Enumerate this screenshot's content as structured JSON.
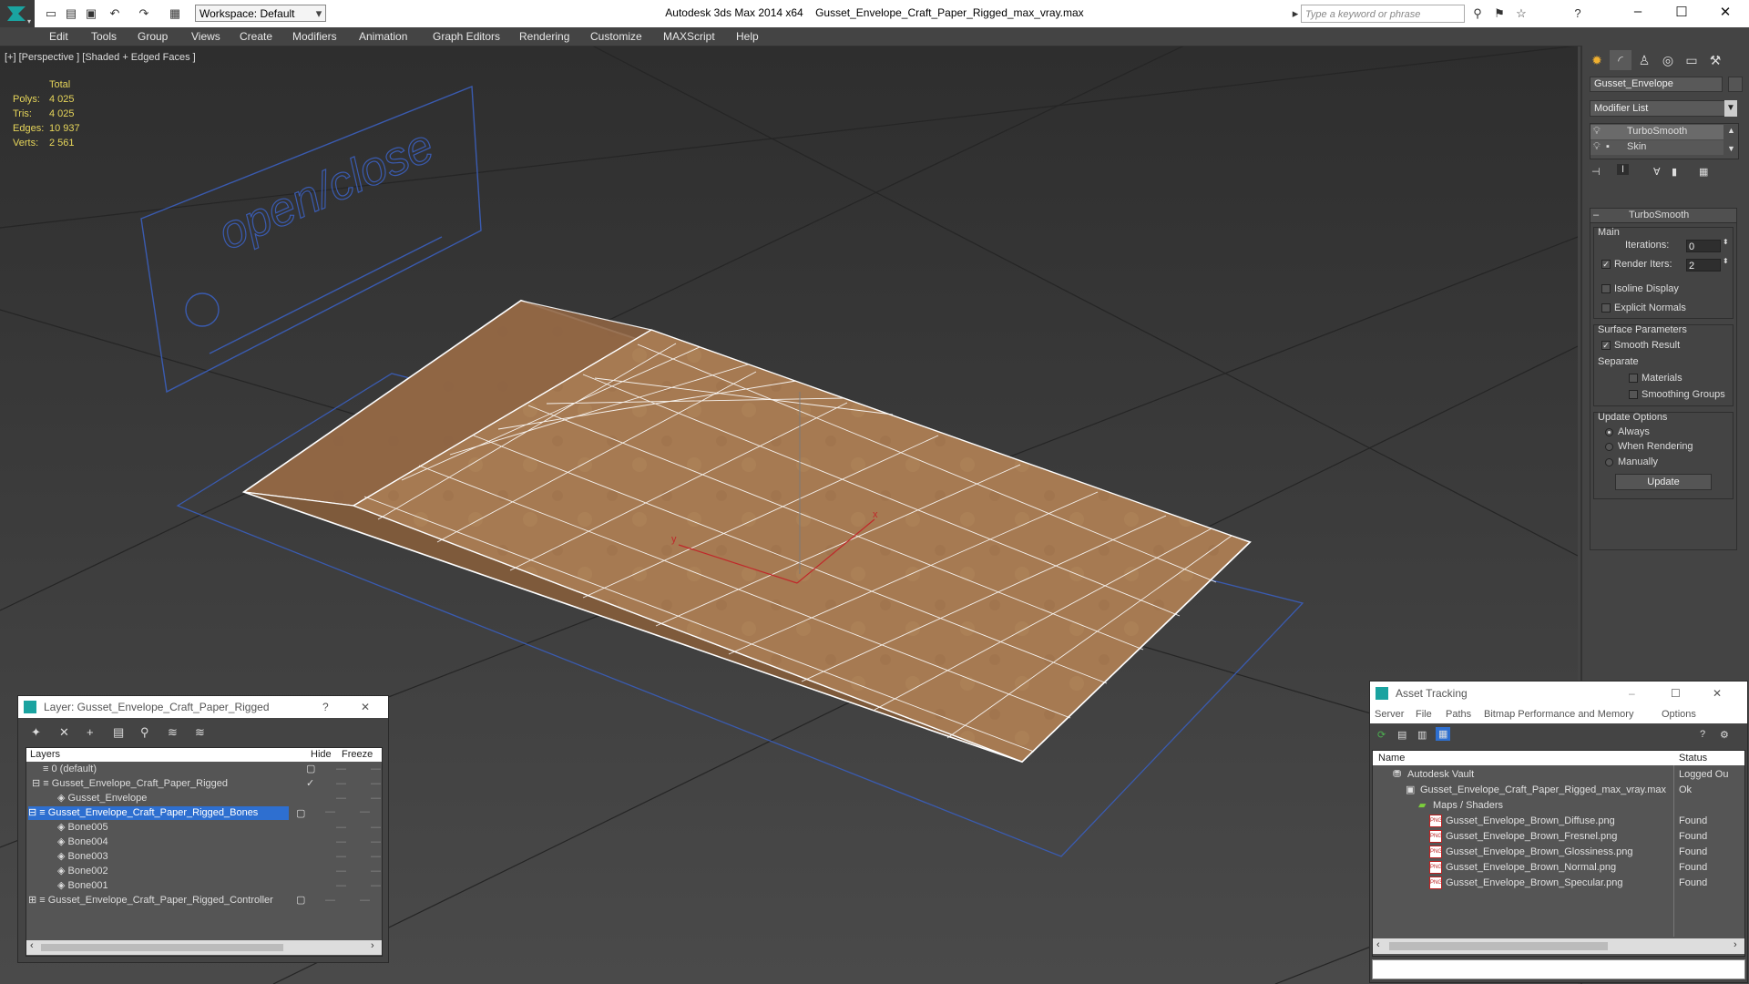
{
  "titlebar": {
    "app": "Autodesk 3ds Max  2014 x64",
    "file": "Gusset_Envelope_Craft_Paper_Rigged_max_vray.max",
    "workspace": "Workspace: Default",
    "search_placeholder": "Type a keyword or phrase"
  },
  "menu": [
    "Edit",
    "Tools",
    "Group",
    "Views",
    "Create",
    "Modifiers",
    "Animation",
    "Graph Editors",
    "Rendering",
    "Customize",
    "MAXScript",
    "Help"
  ],
  "viewport": {
    "label": "[+] [Perspective ] [Shaded + Edged Faces ]",
    "stats": {
      "total": "Total",
      "polys_label": "Polys:",
      "polys": "4 025",
      "tris_label": "Tris:",
      "tris": "4 025",
      "edges_label": "Edges:",
      "edges": "10 937",
      "verts_label": "Verts:",
      "verts": "2 561"
    },
    "sign_text": "open/close",
    "axis_x": "x",
    "axis_y": "y"
  },
  "command_panel": {
    "object_name": "Gusset_Envelope",
    "modifier_list": "Modifier List",
    "stack": [
      "TurboSmooth",
      "Skin"
    ],
    "rollout_title": "TurboSmooth",
    "main": "Main",
    "iterations_label": "Iterations:",
    "iterations": "0",
    "render_iters_label": "Render Iters:",
    "render_iters": "2",
    "render_iters_checked": true,
    "isoline": "Isoline Display",
    "explicit_normals": "Explicit Normals",
    "surface_params": "Surface Parameters",
    "smooth_result": "Smooth Result",
    "separate": "Separate",
    "materials": "Materials",
    "smoothing_groups": "Smoothing Groups",
    "update_options": "Update Options",
    "always": "Always",
    "when_rendering": "When Rendering",
    "manually": "Manually",
    "update_btn": "Update"
  },
  "layer_window": {
    "title": "Layer: Gusset_Envelope_Craft_Paper_Rigged",
    "col_layers": "Layers",
    "col_hide": "Hide",
    "col_freeze": "Freeze",
    "rows": [
      {
        "name": "0 (default)"
      },
      {
        "name": "Gusset_Envelope_Craft_Paper_Rigged"
      },
      {
        "name": "Gusset_Envelope"
      },
      {
        "name": "Gusset_Envelope_Craft_Paper_Rigged_Bones"
      },
      {
        "name": "Bone005"
      },
      {
        "name": "Bone004"
      },
      {
        "name": "Bone003"
      },
      {
        "name": "Bone002"
      },
      {
        "name": "Bone001"
      },
      {
        "name": "Gusset_Envelope_Craft_Paper_Rigged_Controller"
      }
    ]
  },
  "asset_window": {
    "title": "Asset Tracking",
    "menu": [
      "Server",
      "File",
      "Paths",
      "Bitmap Performance and Memory",
      "Options"
    ],
    "col_name": "Name",
    "col_status": "Status",
    "rows": [
      {
        "name": "Autodesk Vault",
        "status": "Logged Ou"
      },
      {
        "name": "Gusset_Envelope_Craft_Paper_Rigged_max_vray.max",
        "status": "Ok"
      },
      {
        "name": "Maps / Shaders",
        "status": ""
      },
      {
        "name": "Gusset_Envelope_Brown_Diffuse.png",
        "status": "Found"
      },
      {
        "name": "Gusset_Envelope_Brown_Fresnel.png",
        "status": "Found"
      },
      {
        "name": "Gusset_Envelope_Brown_Glossiness.png",
        "status": "Found"
      },
      {
        "name": "Gusset_Envelope_Brown_Normal.png",
        "status": "Found"
      },
      {
        "name": "Gusset_Envelope_Brown_Specular.png",
        "status": "Found"
      }
    ]
  }
}
